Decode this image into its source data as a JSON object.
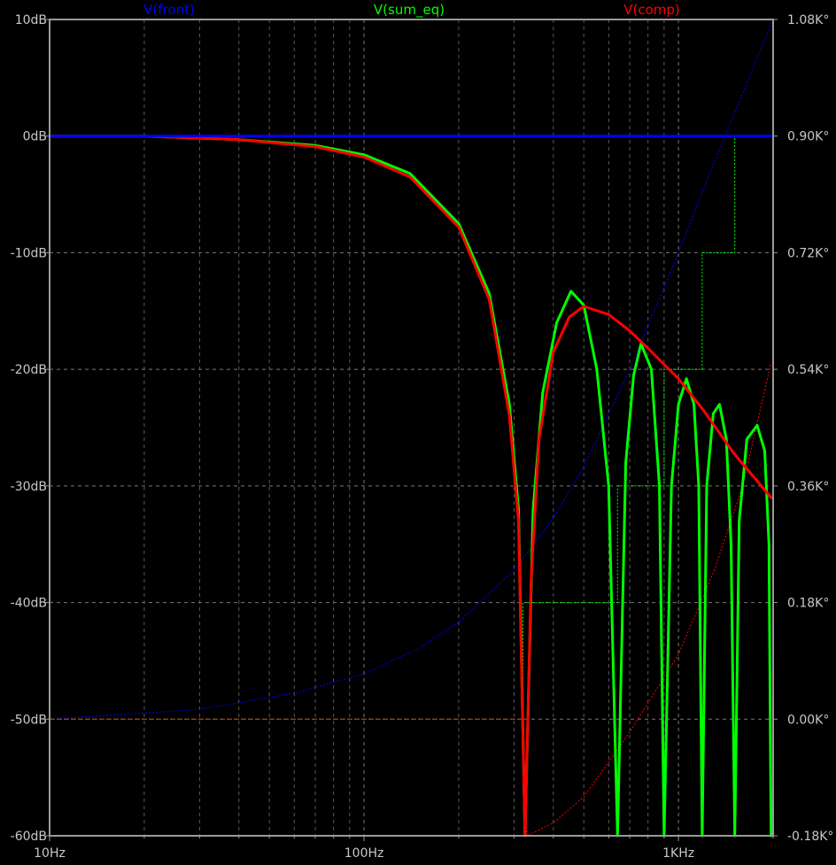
{
  "chart_data": {
    "type": "line",
    "x_scale": "log",
    "xlim_hz": [
      10,
      2000
    ],
    "ylim_db": [
      -60,
      10
    ],
    "y2lim_deg": [
      -180,
      1080
    ],
    "x_ticks": [
      {
        "value": 10,
        "label": "10Hz"
      },
      {
        "value": 100,
        "label": "100Hz"
      },
      {
        "value": 1000,
        "label": "1KHz"
      }
    ],
    "y_ticks": [
      {
        "value": 10,
        "label": "10dB"
      },
      {
        "value": 0,
        "label": "0dB"
      },
      {
        "value": -10,
        "label": "-10dB"
      },
      {
        "value": -20,
        "label": "-20dB"
      },
      {
        "value": -30,
        "label": "-30dB"
      },
      {
        "value": -40,
        "label": "-40dB"
      },
      {
        "value": -50,
        "label": "-50dB"
      },
      {
        "value": -60,
        "label": "-60dB"
      }
    ],
    "y2_ticks": [
      {
        "value": 1080,
        "label": "1.08K°"
      },
      {
        "value": 900,
        "label": "0.90K°"
      },
      {
        "value": 720,
        "label": "0.72K°"
      },
      {
        "value": 540,
        "label": "0.54K°"
      },
      {
        "value": 360,
        "label": "0.36K°"
      },
      {
        "value": 180,
        "label": "0.18K°"
      },
      {
        "value": 0,
        "label": "0.00K°"
      },
      {
        "value": -180,
        "label": "-0.18K°"
      }
    ],
    "grid": true,
    "legend_position": "top",
    "series": [
      {
        "name": "V(front)",
        "color": "#0000ff",
        "magnitude_db": [
          [
            10,
            0
          ],
          [
            2000,
            0
          ]
        ],
        "phase_deg": [
          [
            10,
            0
          ],
          [
            30,
            15
          ],
          [
            60,
            40
          ],
          [
            100,
            70
          ],
          [
            150,
            110
          ],
          [
            200,
            150
          ],
          [
            300,
            230
          ],
          [
            400,
            310
          ],
          [
            500,
            390
          ],
          [
            700,
            540
          ],
          [
            1000,
            720
          ],
          [
            1300,
            860
          ],
          [
            1580,
            960
          ],
          [
            2000,
            1080
          ]
        ]
      },
      {
        "name": "V(sum_eq)",
        "color": "#00ff00",
        "magnitude_db": [
          [
            10,
            0
          ],
          [
            20,
            0
          ],
          [
            40,
            -0.3
          ],
          [
            70,
            -0.8
          ],
          [
            100,
            -1.6
          ],
          [
            140,
            -3.2
          ],
          [
            200,
            -7.5
          ],
          [
            250,
            -13.5
          ],
          [
            290,
            -23
          ],
          [
            310,
            -32
          ],
          [
            325,
            -60
          ],
          [
            345,
            -32
          ],
          [
            370,
            -22
          ],
          [
            410,
            -16
          ],
          [
            455,
            -13.3
          ],
          [
            500,
            -14.5
          ],
          [
            550,
            -20
          ],
          [
            600,
            -30
          ],
          [
            640,
            -60
          ],
          [
            680,
            -28
          ],
          [
            720,
            -20.5
          ],
          [
            760,
            -17.8
          ],
          [
            820,
            -20
          ],
          [
            870,
            -30
          ],
          [
            900,
            -60
          ],
          [
            950,
            -30
          ],
          [
            1000,
            -23
          ],
          [
            1060,
            -20.8
          ],
          [
            1120,
            -23
          ],
          [
            1160,
            -30
          ],
          [
            1190,
            -60
          ],
          [
            1230,
            -30
          ],
          [
            1290,
            -23.8
          ],
          [
            1350,
            -23
          ],
          [
            1420,
            -26
          ],
          [
            1470,
            -35
          ],
          [
            1510,
            -60
          ],
          [
            1560,
            -33
          ],
          [
            1650,
            -26
          ],
          [
            1780,
            -24.8
          ],
          [
            1880,
            -27
          ],
          [
            1940,
            -35
          ],
          [
            1970,
            -60
          ]
        ],
        "phase_deg": [
          [
            10,
            0
          ],
          [
            100,
            0
          ],
          [
            200,
            0
          ],
          [
            300,
            0
          ],
          [
            320,
            0
          ],
          [
            320,
            180
          ],
          [
            640,
            180
          ],
          [
            640,
            360
          ],
          [
            900,
            360
          ],
          [
            900,
            540
          ],
          [
            1190,
            540
          ],
          [
            1190,
            720
          ],
          [
            1510,
            720
          ],
          [
            1510,
            900
          ],
          [
            1970,
            900
          ]
        ]
      },
      {
        "name": "V(comp)",
        "color": "#ff0000",
        "magnitude_db": [
          [
            10,
            0
          ],
          [
            20,
            0
          ],
          [
            40,
            -0.3
          ],
          [
            70,
            -0.9
          ],
          [
            100,
            -1.8
          ],
          [
            140,
            -3.5
          ],
          [
            200,
            -7.8
          ],
          [
            250,
            -14
          ],
          [
            290,
            -24
          ],
          [
            310,
            -33
          ],
          [
            325,
            -60
          ],
          [
            340,
            -38
          ],
          [
            360,
            -26
          ],
          [
            400,
            -18.5
          ],
          [
            450,
            -15.5
          ],
          [
            500,
            -14.6
          ],
          [
            600,
            -15.3
          ],
          [
            700,
            -16.7
          ],
          [
            800,
            -18.2
          ],
          [
            1000,
            -20.8
          ],
          [
            1200,
            -23.5
          ],
          [
            1500,
            -27.2
          ],
          [
            1970,
            -31
          ]
        ],
        "phase_deg": [
          [
            10,
            0
          ],
          [
            320,
            0
          ],
          [
            330,
            -180
          ],
          [
            400,
            -160
          ],
          [
            500,
            -120
          ],
          [
            700,
            -20
          ],
          [
            1000,
            100
          ],
          [
            1300,
            230
          ],
          [
            1600,
            360
          ],
          [
            1970,
            550
          ]
        ]
      }
    ]
  }
}
